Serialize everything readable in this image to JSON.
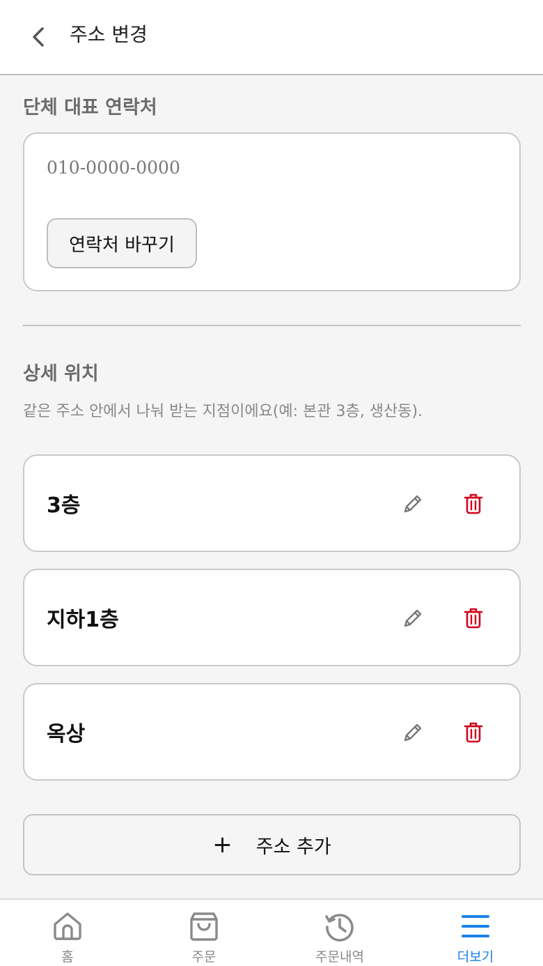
{
  "header": {
    "title": "주소 변경"
  },
  "contact": {
    "section_title": "단체 대표 연락처",
    "value": "010-0000-0000",
    "change_label": "연락처 바꾸기"
  },
  "locations": {
    "section_title": "상세 위치",
    "description": "같은 주소 안에서 나눠 받는 지점이에요(예: 본관 3층, 생산동).",
    "items": [
      {
        "name": "3층"
      },
      {
        "name": "지하1층"
      },
      {
        "name": "옥상"
      }
    ],
    "add_icon": "+",
    "add_label": "주소 추가"
  },
  "nav": {
    "items": [
      {
        "label": "홈",
        "icon": "home-icon"
      },
      {
        "label": "주문",
        "icon": "shopping-bag-icon"
      },
      {
        "label": "주문내역",
        "icon": "history-icon"
      },
      {
        "label": "더보기",
        "icon": "menu-icon"
      }
    ],
    "active_index": 3
  },
  "colors": {
    "accent": "#1a82e8",
    "delete": "#d0021b",
    "background": "#f5f5f5"
  }
}
